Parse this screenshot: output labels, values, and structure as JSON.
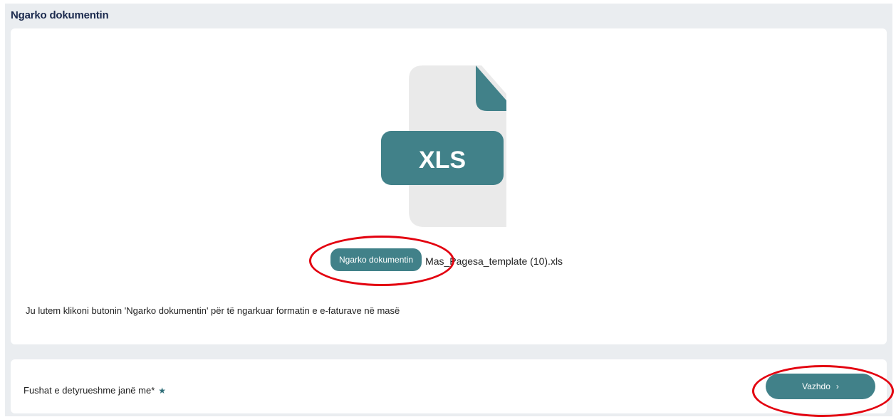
{
  "page": {
    "title": "Ngarko dokumentin"
  },
  "upload": {
    "icon_label": "XLS",
    "button_label": "Ngarko dokumentin",
    "file_name": "Mas_Pagesa_template (10).xls",
    "instruction": "Ju lutem klikoni butonin 'Ngarko dokumentin' për të ngarkuar formatin e e-faturave në masë"
  },
  "footer": {
    "required_note": "Fushat e detyrueshme janë me*",
    "required_icon": "star-icon",
    "continue_label": "Vazhdo",
    "continue_icon": "chevron-right-icon"
  },
  "colors": {
    "accent": "#418189",
    "title": "#1b2a4e",
    "annotation": "#e3000f",
    "background": "#eaedf0"
  }
}
